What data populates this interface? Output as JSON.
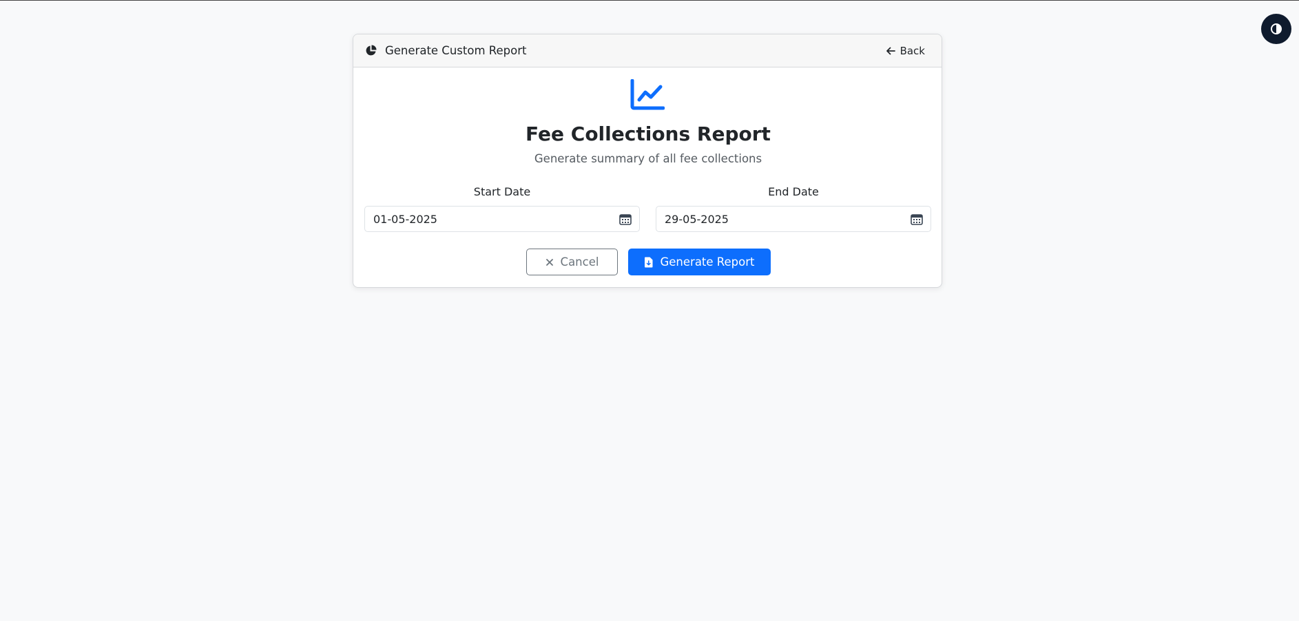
{
  "header": {
    "title": "Generate Custom Report",
    "back_label": "Back"
  },
  "report": {
    "title": "Fee Collections Report",
    "subtitle": "Generate summary of all fee collections"
  },
  "start_date": {
    "label": "Start Date",
    "value": "01-05-2025"
  },
  "end_date": {
    "label": "End Date",
    "value": "29-05-2025"
  },
  "actions": {
    "cancel_label": "Cancel",
    "generate_label": "Generate Report"
  },
  "colors": {
    "accent": "#0d6efd",
    "theme_toggle": "#0f1b2d",
    "background": "#f8f9fa"
  },
  "icons": {
    "header": "pie-chart-icon",
    "back": "arrow-left-icon",
    "report": "line-chart-icon",
    "date": "calendar-icon",
    "cancel": "x-icon",
    "generate": "file-download-icon",
    "theme": "contrast-icon"
  }
}
